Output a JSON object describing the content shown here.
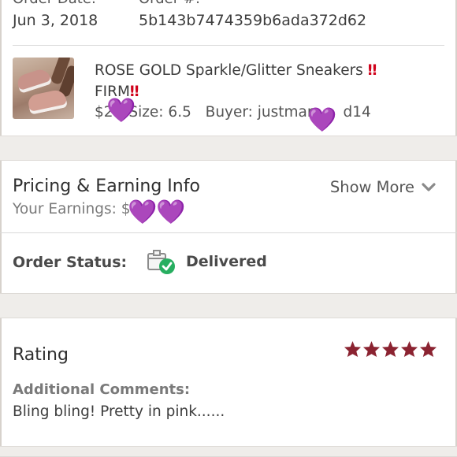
{
  "order": {
    "date_label": "Order Date:",
    "date_value": "Jun 3, 2018",
    "number_label": "Order #:",
    "number_value": "5b143b7474359b6ada372d62"
  },
  "product": {
    "title_line1": "ROSE GOLD Sparkle/Glitter Sneakers ",
    "title_line2": "FIRM",
    "exclaim": "‼",
    "price_visible": "$2",
    "size_text": "Size: 6.5",
    "buyer_text": "Buyer: justmar",
    "buyer_tail": "d14",
    "heart_icon": "purple-heart"
  },
  "pricing": {
    "title": "Pricing & Earning Info",
    "show_more": "Show More",
    "earnings_label": "Your Earnings: $"
  },
  "status": {
    "label": "Order Status:",
    "value": "Delivered"
  },
  "rating": {
    "title": "Rating",
    "stars": 5,
    "star_color": "#8b2331",
    "comments_label": "Additional Comments:",
    "comment": "Bling bling! Pretty in pink......"
  },
  "colors": {
    "heart": "#9b30ff",
    "alert": "#d0021b",
    "success": "#27ae60"
  }
}
